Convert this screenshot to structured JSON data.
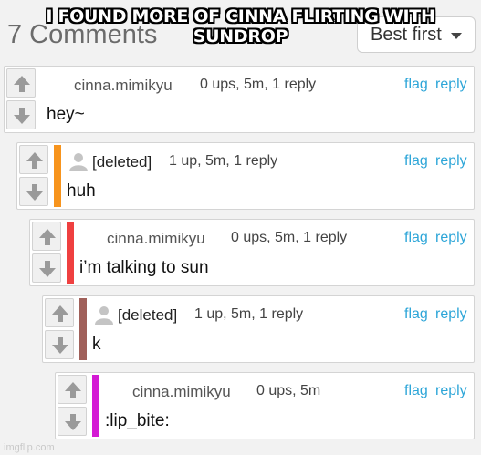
{
  "header": {
    "count_label": "7 Comments",
    "sort_label": "Best first"
  },
  "caption": "I FOUND MORE OF CINNA FLIRTING WITH SUNDROP",
  "comments": [
    {
      "user": "cinna.mimikyu",
      "meta": "0 ups, 5m, 1 reply",
      "text": "hey~",
      "flag": "flag",
      "reply": "reply",
      "accent": ""
    },
    {
      "user": "[deleted]",
      "meta": "1 up, 5m, 1 reply",
      "text": "huh",
      "flag": "flag",
      "reply": "reply",
      "accent": "#f7941d"
    },
    {
      "user": "cinna.mimikyu",
      "meta": "0 ups, 5m, 1 reply",
      "text": "i’m talking to sun",
      "flag": "flag",
      "reply": "reply",
      "accent": "#ef4040"
    },
    {
      "user": "[deleted]",
      "meta": "1 up, 5m, 1 reply",
      "text": "k",
      "flag": "flag",
      "reply": "reply",
      "accent": "#a0605a"
    },
    {
      "user": "cinna.mimikyu",
      "meta": "0 ups, 5m",
      "text": ":lip_bite:",
      "flag": "flag",
      "reply": "reply",
      "accent": "#d41ad4"
    }
  ],
  "watermark": "imgflip.com"
}
